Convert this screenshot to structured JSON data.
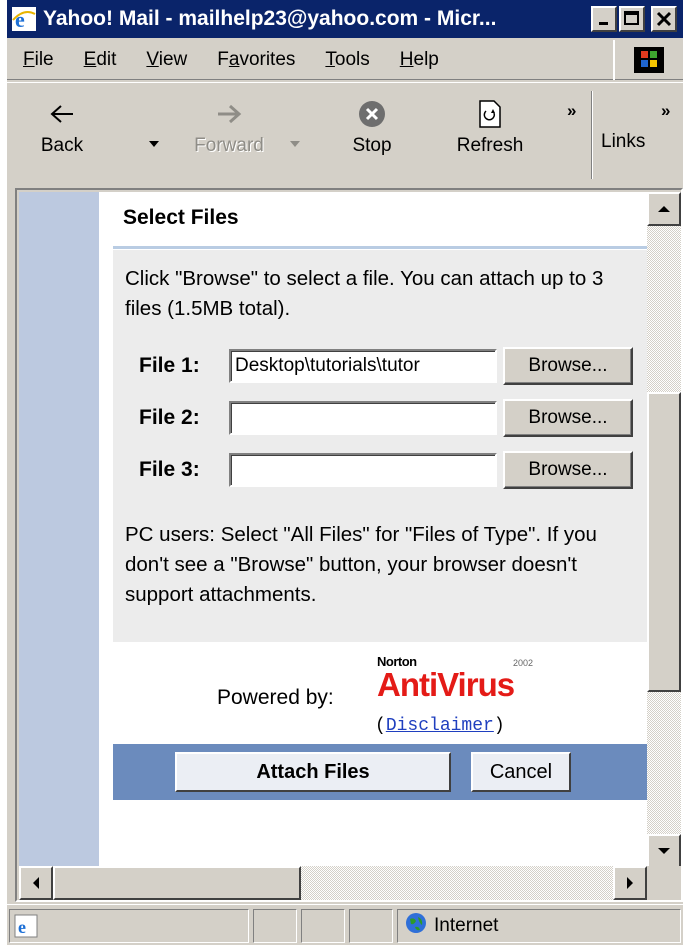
{
  "window": {
    "title": "Yahoo! Mail - mailhelp23@yahoo.com - Micr..."
  },
  "menu": {
    "items": [
      {
        "pre": "",
        "u": "F",
        "post": "ile"
      },
      {
        "pre": "",
        "u": "E",
        "post": "dit"
      },
      {
        "pre": "",
        "u": "V",
        "post": "iew"
      },
      {
        "pre": "F",
        "u": "a",
        "post": "vorites"
      },
      {
        "pre": "",
        "u": "T",
        "post": "ools"
      },
      {
        "pre": "",
        "u": "H",
        "post": "elp"
      }
    ]
  },
  "toolbar": {
    "back": "Back",
    "forward": "Forward",
    "stop": "Stop",
    "refresh": "Refresh",
    "links": "Links",
    "more": "»"
  },
  "page": {
    "heading": "Select Files",
    "intro": "Click \"Browse\" to select a file. You can attach up to 3 files (1.5MB total).",
    "files": [
      {
        "label": "File 1:",
        "value": "Desktop\\tutorials\\tutor"
      },
      {
        "label": "File 2:",
        "value": ""
      },
      {
        "label": "File 3:",
        "value": ""
      }
    ],
    "browse_label": "Browse...",
    "note": "PC users: Select \"All Files\" for \"Files of Type\". If you don't see a \"Browse\" button, your browser doesn't support attachments.",
    "powered_by": "Powered by:",
    "norton": "Norton",
    "antivirus": "AntiVirus",
    "year": "2002",
    "disclaimer_open": "(",
    "disclaimer": "Disclaimer",
    "disclaimer_close": ")",
    "attach_button": "Attach Files",
    "cancel_button": "Cancel"
  },
  "status": {
    "zone": "Internet"
  },
  "colors": {
    "titlebar": "#0a246a",
    "sidebar": "#bcc9e0",
    "action_bar": "#6b8bbd",
    "norton_red": "#e41b17",
    "link": "#1f3fbf"
  }
}
